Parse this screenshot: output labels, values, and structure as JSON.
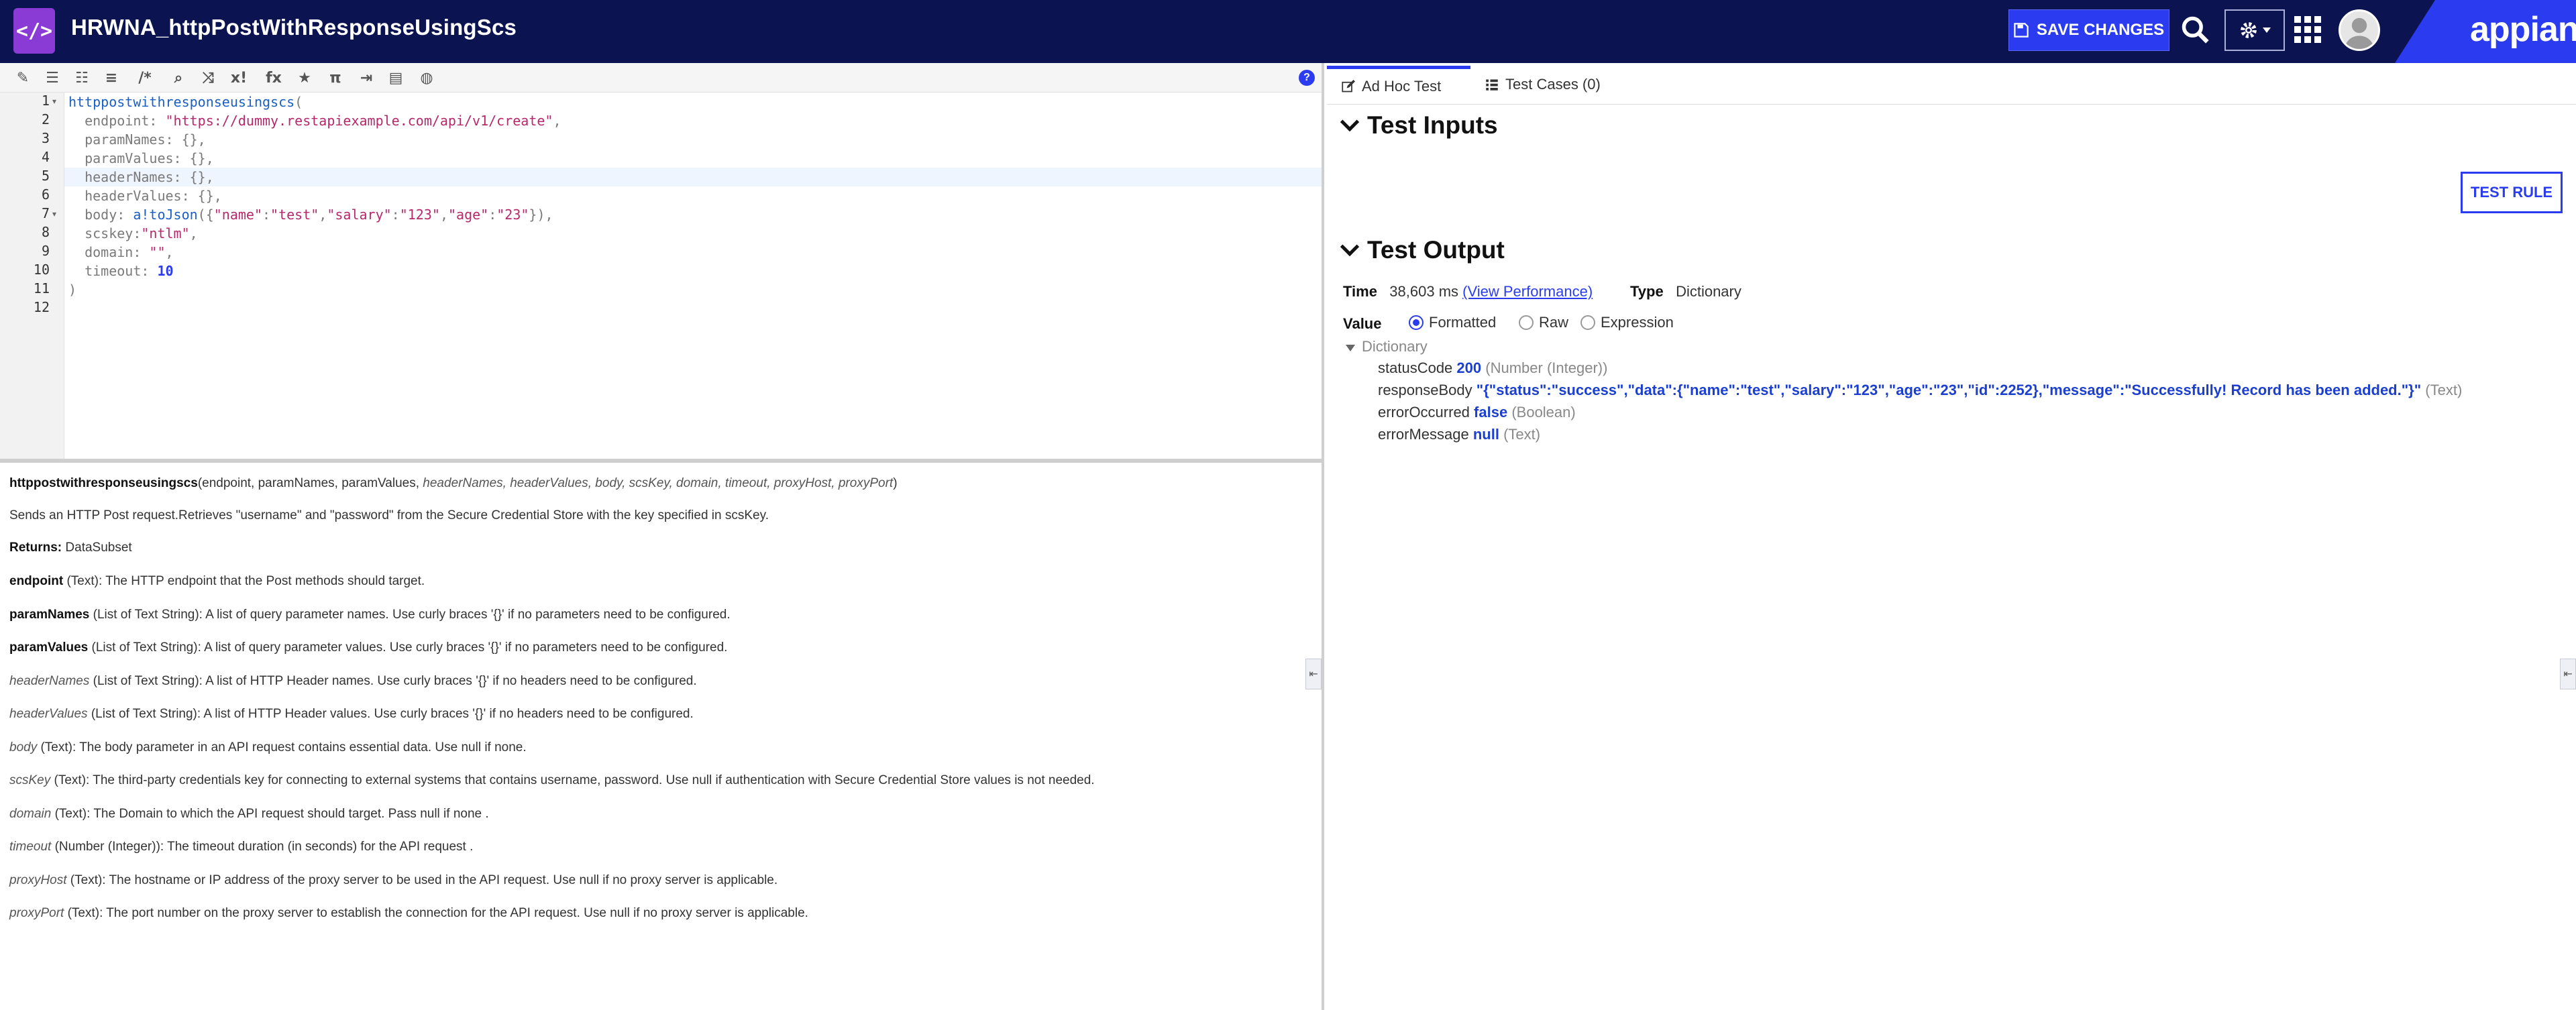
{
  "header": {
    "rule_icon_glyph": "</>",
    "title": "HRWNA_httpPostWithResponseUsingScs",
    "save_label": "SAVE CHANGES",
    "brand": "appian",
    "colors": {
      "nav_bg": "#0b1350",
      "accent": "#2b3cf0",
      "rule_icon": "#8a3bd6"
    }
  },
  "toolbar": {
    "icons": [
      "wand-icon",
      "indent-icon",
      "outdent-icon",
      "list-icon",
      "comment-icon",
      "search-icon",
      "shuffle-icon",
      "variable-icon",
      "function-icon",
      "star-icon",
      "pi-icon",
      "export-icon",
      "template-icon",
      "preview-icon",
      "help-icon"
    ],
    "glyphs": [
      "✎",
      "☰",
      "☷",
      "≡",
      "/*",
      "⌕",
      "⤨",
      "x!",
      "fx",
      "★",
      "π",
      "⇥",
      "▤",
      "◍",
      "?"
    ]
  },
  "editor": {
    "line_numbers": [
      "1",
      "2",
      "3",
      "4",
      "5",
      "6",
      "7",
      "8",
      "9",
      "10",
      "11",
      "12"
    ],
    "lines": [
      [
        {
          "t": "httppostwithresponseusingscs",
          "c": "fn"
        },
        {
          "t": "(",
          "c": "kw"
        }
      ],
      [
        {
          "t": "  endpoint: ",
          "c": "kw"
        },
        {
          "t": "\"https://dummy.restapiexample.com/api/v1/create\"",
          "c": "str"
        },
        {
          "t": ",",
          "c": "kw"
        }
      ],
      [
        {
          "t": "  paramNames: {},",
          "c": "kw"
        }
      ],
      [
        {
          "t": "  paramValues: {},",
          "c": "kw"
        }
      ],
      [
        {
          "t": "  headerNames: {},",
          "c": "kw"
        }
      ],
      [
        {
          "t": "  headerValues: {},",
          "c": "kw"
        }
      ],
      [
        {
          "t": "  body: ",
          "c": "kw"
        },
        {
          "t": "a!toJson",
          "c": "fn"
        },
        {
          "t": "({",
          "c": "kw"
        },
        {
          "t": "\"name\"",
          "c": "str"
        },
        {
          "t": ":",
          "c": "kw"
        },
        {
          "t": "\"test\"",
          "c": "str"
        },
        {
          "t": ",",
          "c": "kw"
        },
        {
          "t": "\"salary\"",
          "c": "str"
        },
        {
          "t": ":",
          "c": "kw"
        },
        {
          "t": "\"123\"",
          "c": "str"
        },
        {
          "t": ",",
          "c": "kw"
        },
        {
          "t": "\"age\"",
          "c": "str"
        },
        {
          "t": ":",
          "c": "kw"
        },
        {
          "t": "\"23\"",
          "c": "str"
        },
        {
          "t": "}),",
          "c": "kw"
        }
      ],
      [
        {
          "t": "  scskey:",
          "c": "kw"
        },
        {
          "t": "\"ntlm\"",
          "c": "str"
        },
        {
          "t": ",",
          "c": "kw"
        }
      ],
      [
        {
          "t": "  domain: ",
          "c": "kw"
        },
        {
          "t": "\"\"",
          "c": "str"
        },
        {
          "t": ",",
          "c": "kw"
        }
      ],
      [
        {
          "t": "  timeout: ",
          "c": "kw"
        },
        {
          "t": "10",
          "c": "num"
        }
      ],
      [
        {
          "t": ")",
          "c": "kw"
        }
      ],
      []
    ]
  },
  "docs": {
    "signature_name": "httppostwithresponseusingscs",
    "signature_params_plain": "(endpoint, paramNames, paramValues, ",
    "signature_params_italic": "headerNames, headerValues, body, scsKey, domain, timeout, proxyHost, proxyPort",
    "signature_close": ")",
    "description": "Sends an HTTP Post request.Retrieves \"username\" and \"password\" from the Secure Credential Store with the key specified in scsKey.",
    "returns_label": "Returns:",
    "returns_value": " DataSubset",
    "params": [
      {
        "name": "endpoint",
        "required": true,
        "desc": " (Text): The HTTP endpoint that the Post methods should target."
      },
      {
        "name": "paramNames",
        "required": true,
        "desc": " (List of Text String): A list of query parameter names. Use curly braces '{}' if no parameters need to be configured."
      },
      {
        "name": "paramValues",
        "required": true,
        "desc": " (List of Text String): A list of query parameter values. Use curly braces '{}' if no parameters need to be configured."
      },
      {
        "name": "headerNames",
        "required": false,
        "desc": " (List of Text String): A list of HTTP Header names. Use curly braces '{}' if no headers need to be configured."
      },
      {
        "name": "headerValues",
        "required": false,
        "desc": " (List of Text String): A list of HTTP Header values. Use curly braces '{}' if no headers need to be configured."
      },
      {
        "name": "body",
        "required": false,
        "desc": " (Text): The body parameter in an API request contains essential data. Use null if none."
      },
      {
        "name": "scsKey",
        "required": false,
        "desc": " (Text): The third-party credentials key for connecting to external systems that contains username, password. Use null if authentication with Secure Credential Store values is not needed."
      },
      {
        "name": "domain",
        "required": false,
        "desc": " (Text): The Domain to which the API request should target. Pass null if none ."
      },
      {
        "name": "timeout",
        "required": false,
        "desc": " (Number (Integer)): The timeout duration (in seconds) for the API request ."
      },
      {
        "name": "proxyHost",
        "required": false,
        "desc": " (Text): The hostname or IP address of the proxy server to be used in the API request. Use null if no proxy server is applicable."
      },
      {
        "name": "proxyPort",
        "required": false,
        "desc": " (Text): The port number on the proxy server to establish the connection for the API request. Use null if no proxy server is applicable."
      }
    ]
  },
  "tabs": {
    "adhoc": "Ad Hoc Test",
    "cases": "Test Cases (0)"
  },
  "test": {
    "inputs_title": "Test Inputs",
    "test_rule_label": "TEST RULE",
    "output_title": "Test Output",
    "time_label": "Time",
    "time_value": "38,603 ms",
    "perf_link": "(View Performance)",
    "type_label": "Type",
    "type_value": "Dictionary",
    "value_label": "Value",
    "modes": [
      "Formatted",
      "Raw",
      "Expression"
    ],
    "selected_mode": "Formatted",
    "tree_root": "Dictionary",
    "fields": [
      {
        "key": "statusCode",
        "value": "200",
        "type": "(Number (Integer))"
      },
      {
        "key": "responseBody",
        "value": "\"{\"status\":\"success\",\"data\":{\"name\":\"test\",\"salary\":\"123\",\"age\":\"23\",\"id\":2252},\"message\":\"Successfully! Record has been added.\"}\"",
        "type": "(Text)"
      },
      {
        "key": "errorOccurred",
        "value": "false",
        "type": "(Boolean)"
      },
      {
        "key": "errorMessage",
        "value": "null",
        "type": "(Text)"
      }
    ]
  },
  "handles": {
    "left_glyph": "⇤",
    "right_glyph": "⇤"
  }
}
